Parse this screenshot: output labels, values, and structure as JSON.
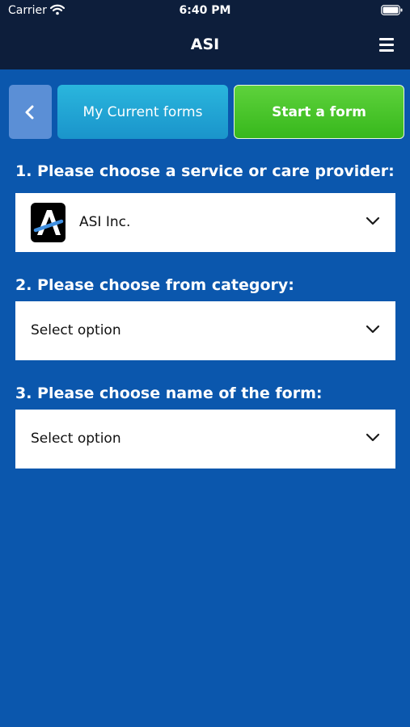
{
  "status_bar": {
    "carrier": "Carrier",
    "time": "6:40 PM",
    "icons": [
      "wifi-icon",
      "battery-icon"
    ]
  },
  "nav": {
    "title": "ASI",
    "menu_icon": "hamburger-menu-icon"
  },
  "tabs": {
    "back_icon": "chevron-left-icon",
    "current_forms_label": "My Current forms",
    "start_form_label": "Start a form"
  },
  "form": {
    "q1_label": "1. Please choose a service or care provider:",
    "q1_value": "ASI Inc.",
    "q2_label": "2. Please choose from category:",
    "q2_value": "Select option",
    "q3_label": "3. Please choose name of the form:",
    "q3_value": "Select option"
  },
  "colors": {
    "background": "#0b57ad",
    "header": "#0d1e3b",
    "current_tab": "#1fa6d6",
    "start_tab": "#4cc62e",
    "back_button": "#5b8fd6"
  }
}
